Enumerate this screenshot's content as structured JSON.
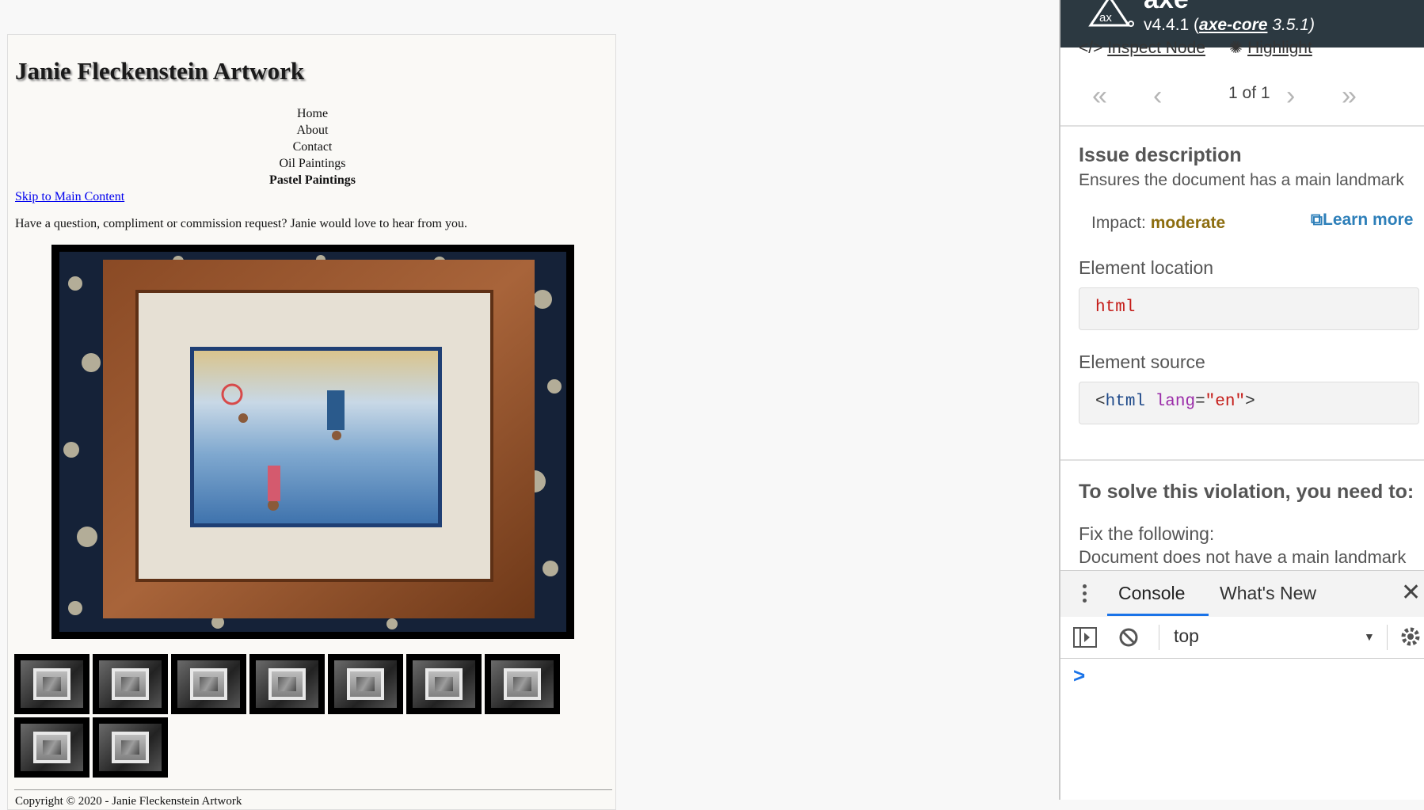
{
  "site": {
    "title": "Janie Fleckenstein Artwork",
    "nav": [
      "Home",
      "About",
      "Contact",
      "Oil Paintings",
      "Pastel Paintings"
    ],
    "current_nav": "Pastel Paintings",
    "skip_link": "Skip to Main Content",
    "intro": "Have a question, compliment or commission request? Janie would love to hear from you.",
    "thumbnail_count": 9,
    "footer": "Copyright © 2020 - Janie Fleckenstein Artwork"
  },
  "axe": {
    "title": "axe",
    "version_prefix": "v4.4.1 (",
    "core_link": "axe-core",
    "core_version": " 3.5.1)",
    "inspect_node": "Inspect Node",
    "highlight": "Highlight",
    "pager": {
      "count": "1 of 1"
    },
    "issue_heading": "Issue description",
    "issue_description": "Ensures the document has a main landmark",
    "impact_label": "Impact:",
    "impact_value": "moderate",
    "learn_more": "Learn more",
    "element_location_label": "Element location",
    "element_location": "html",
    "element_source_label": "Element source",
    "element_source": {
      "tag_open": "<",
      "tag_name": "html",
      "attr": "lang",
      "eq": "=",
      "value": "\"en\"",
      "tag_close": ">"
    },
    "solve_heading": "To solve this violation, you need to:",
    "fix_heading": "Fix the following:",
    "fix_detail": "Document does not have a main landmark"
  },
  "drawer": {
    "tabs": [
      "Console",
      "What's New"
    ],
    "context": "top",
    "prompt": ">"
  },
  "colors": {
    "axe_header": "#2c3941",
    "impact_moderate": "#8c6d0f",
    "link_blue": "#2d7fb9",
    "tab_active": "#1a73e8"
  }
}
